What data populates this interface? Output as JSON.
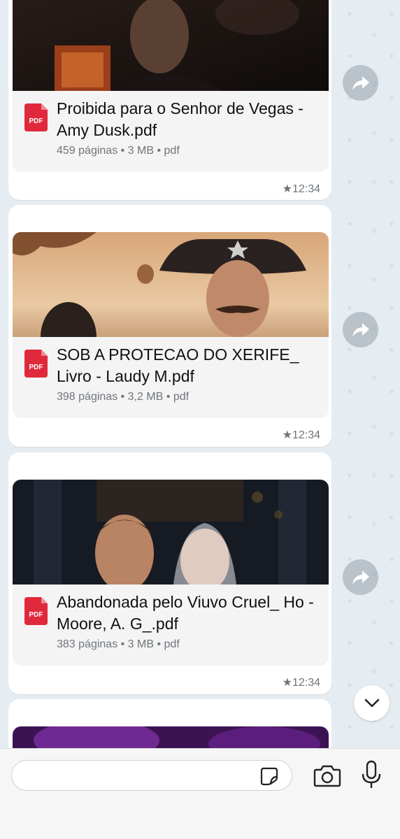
{
  "messages": [
    {
      "title": "Proibida para o Senhor de Vegas - Amy Dusk.pdf",
      "meta": "459 páginas • 3 MB • pdf",
      "time": "12:34",
      "type_label": "PDF"
    },
    {
      "title": "SOB A PROTECAO DO XERIFE_ Livro - Laudy M.pdf",
      "meta": "398 páginas • 3,2 MB • pdf",
      "time": "12:34",
      "type_label": "PDF"
    },
    {
      "title": "Abandonada pelo Viuvo Cruel_ Ho - Moore, A. G_.pdf",
      "meta": "383 páginas • 3 MB • pdf",
      "time": "12:34",
      "type_label": "PDF"
    }
  ],
  "composer": {
    "placeholder": ""
  },
  "colors": {
    "pdf_red": "#e0293b",
    "bubble": "#ffffff",
    "doc_bg": "#f4f4f5",
    "meta": "#707579"
  }
}
